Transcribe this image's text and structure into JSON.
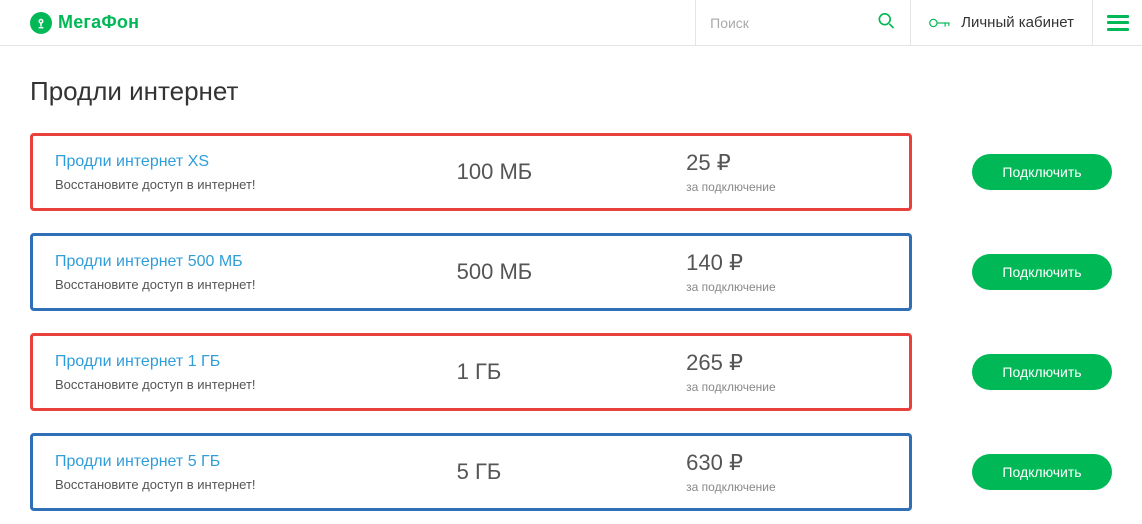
{
  "header": {
    "brand": "МегаФон",
    "search_placeholder": "Поиск",
    "lk_label": "Личный кабинет"
  },
  "page": {
    "title": "Продли интернет"
  },
  "tariffs": [
    {
      "name": "Продли интернет XS",
      "subtitle": "Восстановите доступ в интернет!",
      "volume": "100 МБ",
      "price": "25 ₽",
      "price_sub": "за подключение",
      "button": "Подключить",
      "border": "red"
    },
    {
      "name": "Продли интернет 500 МБ",
      "subtitle": "Восстановите доступ в интернет!",
      "volume": "500 МБ",
      "price": "140 ₽",
      "price_sub": "за подключение",
      "button": "Подключить",
      "border": "blue"
    },
    {
      "name": "Продли интернет 1 ГБ",
      "subtitle": "Восстановите доступ в интернет!",
      "volume": "1 ГБ",
      "price": "265 ₽",
      "price_sub": "за подключение",
      "button": "Подключить",
      "border": "red"
    },
    {
      "name": "Продли интернет 5 ГБ",
      "subtitle": "Восстановите доступ в интернет!",
      "volume": "5 ГБ",
      "price": "630 ₽",
      "price_sub": "за подключение",
      "button": "Подключить",
      "border": "blue"
    }
  ]
}
